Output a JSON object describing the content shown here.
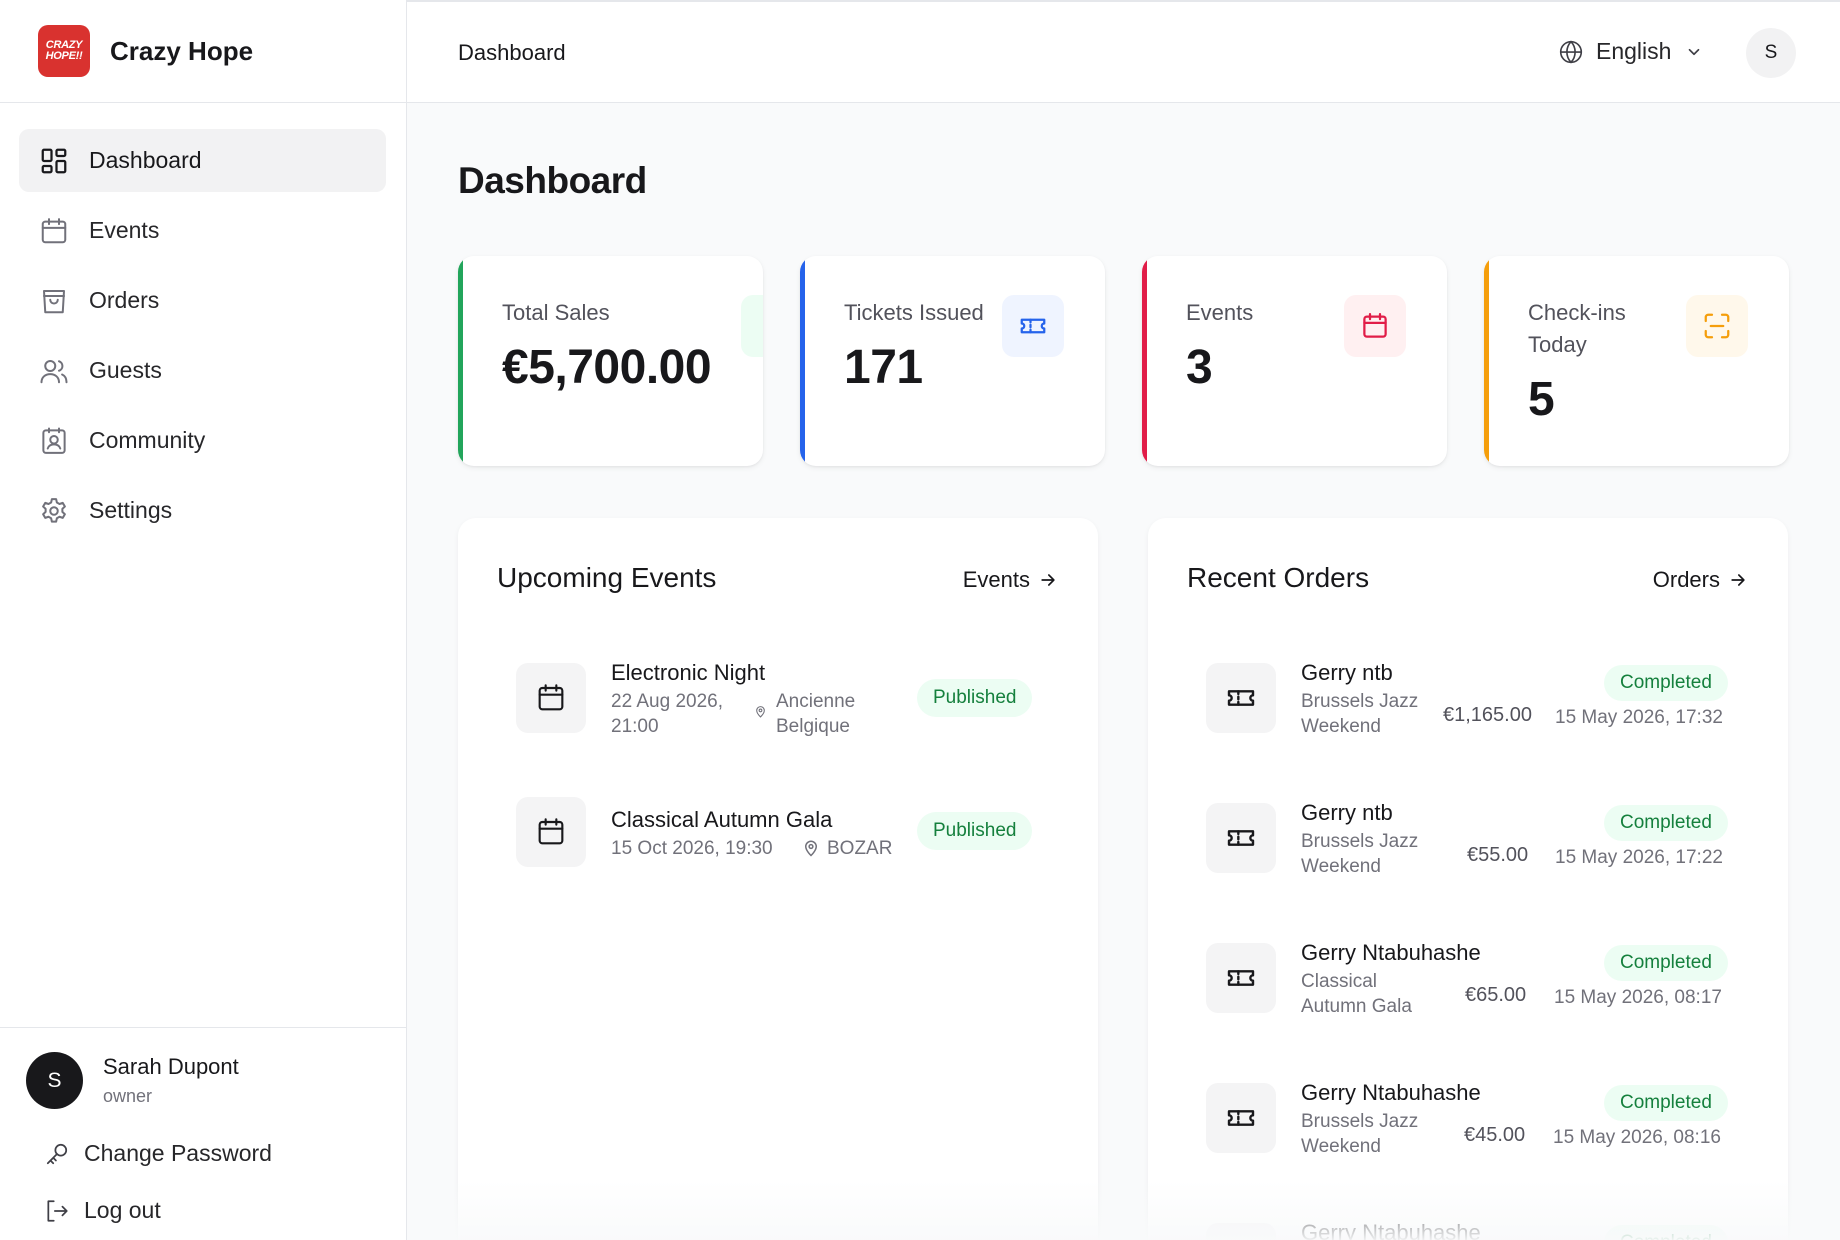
{
  "brand": {
    "name": "Crazy Hope",
    "logo_text_1": "CRAZY",
    "logo_text_2": "HOPE!!"
  },
  "sidebar": {
    "items": [
      {
        "label": "Dashboard",
        "icon": "layout-grid-icon"
      },
      {
        "label": "Events",
        "icon": "calendar-icon"
      },
      {
        "label": "Orders",
        "icon": "shopping-bag-icon"
      },
      {
        "label": "Guests",
        "icon": "users-icon"
      },
      {
        "label": "Community",
        "icon": "contact-card-icon"
      },
      {
        "label": "Settings",
        "icon": "gear-icon"
      }
    ],
    "user": {
      "initial": "S",
      "name": "Sarah Dupont",
      "role": "owner"
    },
    "change_password": "Change Password",
    "logout": "Log out"
  },
  "topbar": {
    "title": "Dashboard",
    "language": "English",
    "avatar_initial": "S"
  },
  "page_title": "Dashboard",
  "stats": [
    {
      "label": "Total Sales",
      "value": "€5,700.00",
      "accent": "#22a55b",
      "icon": "dollar-icon"
    },
    {
      "label": "Tickets Issued",
      "value": "171",
      "accent": "#2563eb",
      "icon": "ticket-icon"
    },
    {
      "label": "Events",
      "value": "3",
      "accent": "#e11d48",
      "icon": "calendar-icon"
    },
    {
      "label": "Check-ins Today",
      "value": "5",
      "accent": "#f59e0b",
      "icon": "scan-icon"
    }
  ],
  "upcoming": {
    "title": "Upcoming Events",
    "link": "Events",
    "items": [
      {
        "name": "Electronic Night",
        "date": "22 Aug 2026, 21:00",
        "venue": "Ancienne Belgique",
        "status": "Published"
      },
      {
        "name": "Classical Autumn Gala",
        "date": "15 Oct 2026, 19:30",
        "venue": "BOZAR",
        "status": "Published"
      }
    ]
  },
  "orders": {
    "title": "Recent Orders",
    "link": "Orders",
    "items": [
      {
        "name": "Gerry ntb",
        "event": "Brussels Jazz Weekend",
        "amount": "€1,165.00",
        "status": "Completed",
        "date": "15 May 2026, 17:32"
      },
      {
        "name": "Gerry ntb",
        "event": "Brussels Jazz Weekend",
        "amount": "€55.00",
        "status": "Completed",
        "date": "15 May 2026, 17:22"
      },
      {
        "name": "Gerry Ntabuhashe",
        "event": "Classical Autumn Gala",
        "amount": "€65.00",
        "status": "Completed",
        "date": "15 May 2026, 08:17"
      },
      {
        "name": "Gerry Ntabuhashe",
        "event": "Brussels Jazz Weekend",
        "amount": "€45.00",
        "status": "Completed",
        "date": "15 May 2026, 08:16"
      },
      {
        "name": "Gerry Ntabuhashe",
        "status": "Completed"
      }
    ]
  }
}
